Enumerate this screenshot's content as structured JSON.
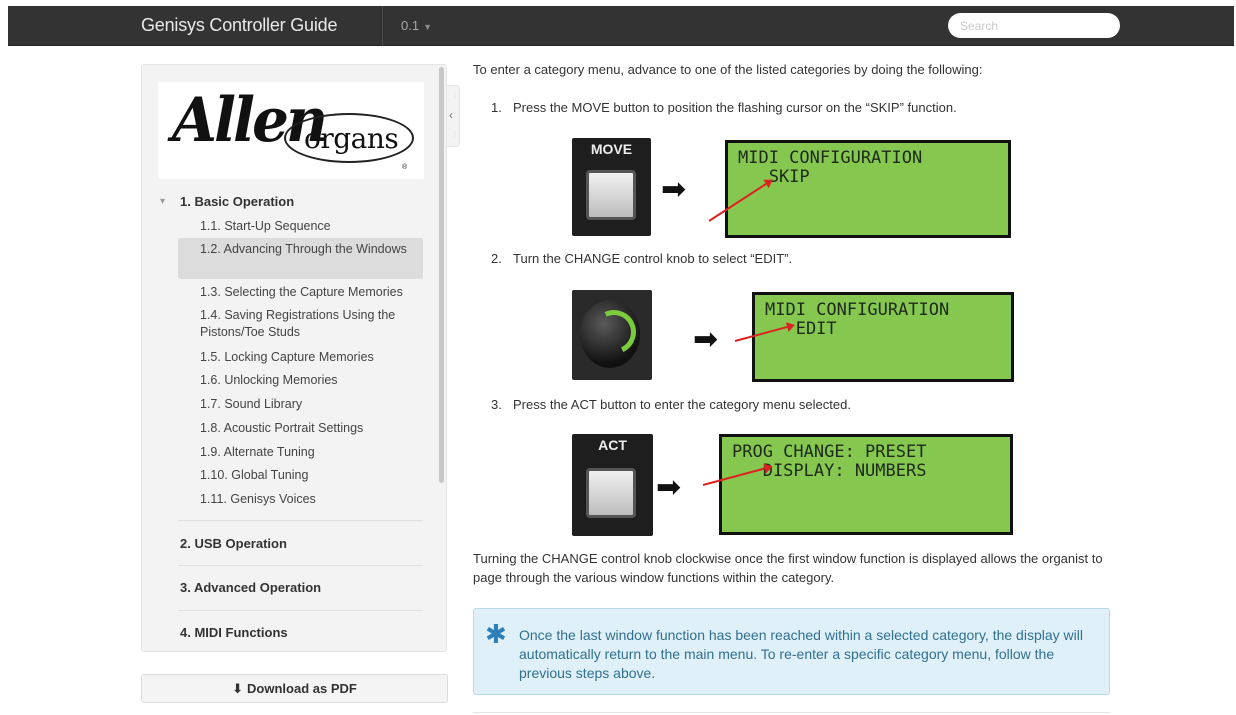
{
  "topbar": {
    "title": "Genisys Controller Guide",
    "version": "0.1",
    "search_placeholder": "Search"
  },
  "sidebar": {
    "logo": {
      "word": "Allen",
      "tail": "organs",
      "reg": "®"
    },
    "section_title": "1. Basic Operation",
    "items": [
      "1.1. Start-Up Sequence",
      "1.2. Advancing Through the Windows",
      "1.3. Selecting the Capture Memories",
      "1.4. Saving Registrations Using the Pistons/Toe Studs",
      "1.5. Locking Capture Memories",
      "1.6. Unlocking Memories",
      "1.7. Sound Library",
      "1.8. Acoustic Portrait Settings",
      "1.9. Alternate Tuning",
      "1.10. Global Tuning",
      "1.11. Genisys Voices"
    ],
    "major_sections": [
      "2. USB Operation",
      "3. Advanced Operation",
      "4. MIDI Functions"
    ],
    "download_label": "Download as PDF"
  },
  "content": {
    "intro": "To enter a category menu, advance to one of the listed categories by doing the following:",
    "steps": [
      "Press the MOVE button to position the flashing cursor on the “SKIP” function.",
      "Turn the CHANGE control knob to select “EDIT”.",
      "Press the ACT button to enter the category menu selected."
    ],
    "step_numbers": [
      "1.",
      "2.",
      "3."
    ],
    "figures": {
      "move_label": "MOVE",
      "act_label": "ACT",
      "lcd1": "MIDI CONFIGURATION\n   SKIP",
      "lcd2": "MIDI CONFIGURATION\n   EDIT",
      "lcd3": "PROG CHANGE: PRESET\n   DISPLAY: NUMBERS"
    },
    "paragraph": "Turning the CHANGE control knob clockwise once the first window function is displayed allows the organist to page through the various window functions within the category.",
    "note": "Once the last window function has been reached within a selected category, the display will automatically return to the main menu. To re-enter a specific category menu, follow the previous steps above."
  },
  "colors": {
    "topbar": "#333333",
    "lcd_green": "#86c74f",
    "note_bg": "#dff0f8",
    "note_text": "#31708f",
    "arrow_red": "#dd2222"
  }
}
